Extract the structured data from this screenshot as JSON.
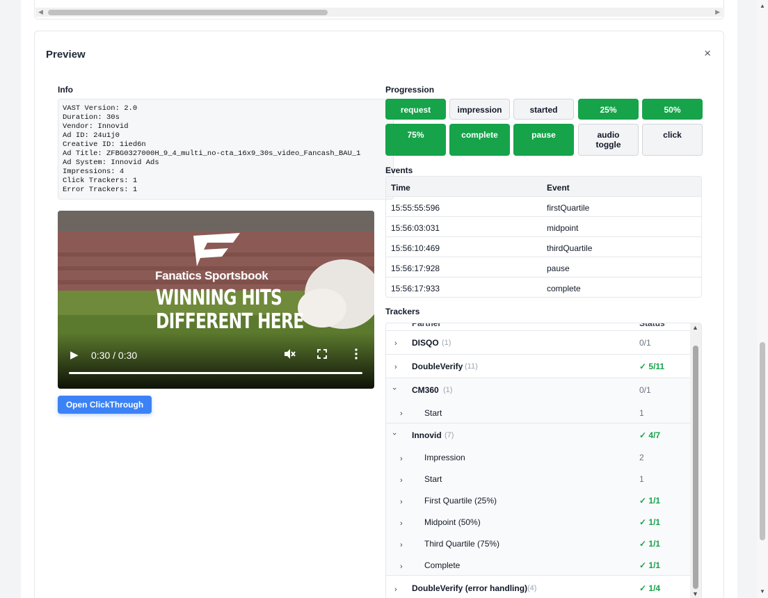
{
  "preview": {
    "title": "Preview",
    "close_label": "×"
  },
  "info": {
    "label": "Info",
    "lines": [
      "VAST Version: 2.0",
      "Duration: 30s",
      "Vendor: Innovid",
      "Ad ID: 24u1j0",
      "Creative ID: 1ied6n",
      "Ad Title: ZFBG0327000H_9_4_multi_no-cta_16x9_30s_video_Fancash_BAU_1",
      "Ad System: Innovid Ads",
      "Impressions: 4",
      "Click Trackers: 1",
      "Error Trackers: 1"
    ]
  },
  "video": {
    "brand_text": "Fanatics Sportsbook",
    "headline_1": "WINNING HITS",
    "headline_2": "DIFFERENT HERE",
    "time": "0:30 / 0:30",
    "progress": 1.0,
    "play_icon": "play-icon",
    "mute_icon": "muted-icon",
    "fullscreen_icon": "fullscreen-icon",
    "menu_icon": "more-vertical-icon"
  },
  "clickthrough_label": "Open ClickThrough",
  "progression": {
    "label": "Progression",
    "buttons": [
      {
        "label": "request",
        "active": true
      },
      {
        "label": "impression",
        "active": false
      },
      {
        "label": "started",
        "active": false
      },
      {
        "label": "25%",
        "active": true
      },
      {
        "label": "50%",
        "active": true
      },
      {
        "label": "75%",
        "active": true
      },
      {
        "label": "complete",
        "active": true
      },
      {
        "label": "pause",
        "active": true
      },
      {
        "label": "audio toggle",
        "active": false
      },
      {
        "label": "click",
        "active": false
      }
    ],
    "active_color": "#16a34a"
  },
  "events": {
    "label": "Events",
    "columns": [
      "Time",
      "Event"
    ],
    "rows": [
      [
        "15:55:55:596",
        "firstQuartile"
      ],
      [
        "15:56:03:031",
        "midpoint"
      ],
      [
        "15:56:10:469",
        "thirdQuartile"
      ],
      [
        "15:56:17:928",
        "pause"
      ],
      [
        "15:56:17:933",
        "complete"
      ]
    ]
  },
  "trackers": {
    "label": "Trackers",
    "columns": [
      "Partner",
      "Status"
    ],
    "rows": [
      {
        "name": "DISQO",
        "count": "(1)",
        "status": "0/1",
        "ok": false
      },
      {
        "name": "DoubleVerify",
        "count": "(11)",
        "status": "✓ 5/11",
        "ok": true
      },
      {
        "name": "CM360",
        "count": "(1)",
        "status": "0/1",
        "ok": false
      },
      {
        "name": "Start",
        "status": "1",
        "ok": false
      },
      {
        "name": "Innovid",
        "count": "(7)",
        "status": "✓ 4/7",
        "ok": true
      },
      {
        "name": "Impression",
        "status": "2",
        "ok": false
      },
      {
        "name": "Start",
        "status": "1",
        "ok": false
      },
      {
        "name": "First Quartile (25%)",
        "status": "✓ 1/1",
        "ok": true
      },
      {
        "name": "Midpoint (50%)",
        "status": "✓ 1/1",
        "ok": true
      },
      {
        "name": "Third Quartile (75%)",
        "status": "✓ 1/1",
        "ok": true
      },
      {
        "name": "Complete",
        "status": "✓ 1/1",
        "ok": true
      },
      {
        "name": "DoubleVerify (error handling)",
        "count": "(4)",
        "status": "✓ 1/4",
        "ok": true
      }
    ]
  }
}
